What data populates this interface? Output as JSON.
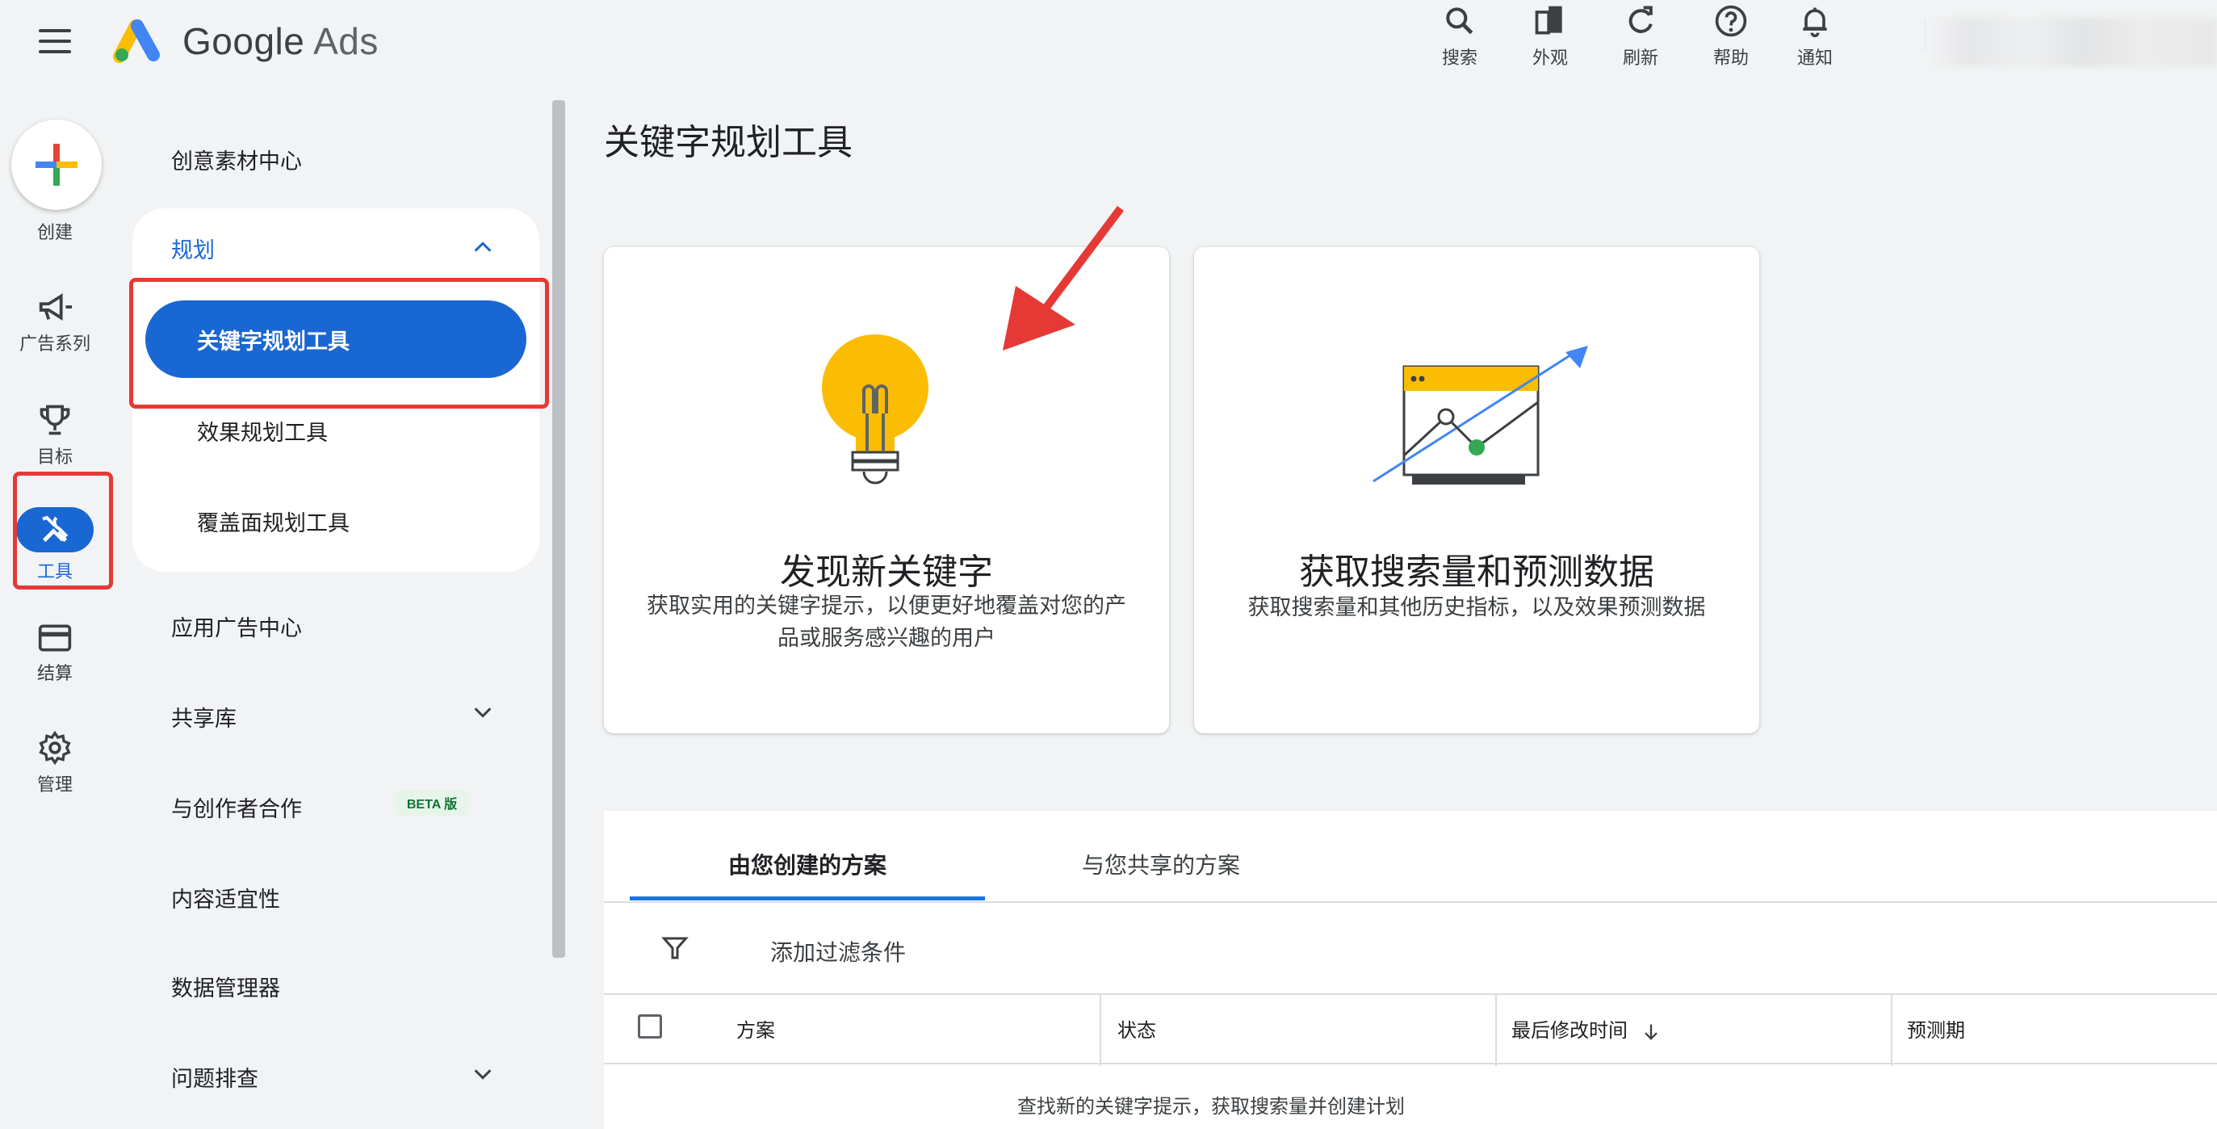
{
  "header": {
    "brand_google": "Google",
    "brand_ads": "Ads",
    "actions": [
      {
        "label": "搜索",
        "icon": "search-icon"
      },
      {
        "label": "外观",
        "icon": "appearance-icon"
      },
      {
        "label": "刷新",
        "icon": "refresh-icon"
      },
      {
        "label": "帮助",
        "icon": "help-icon"
      },
      {
        "label": "通知",
        "icon": "bell-icon"
      }
    ]
  },
  "rail": {
    "create": "创建",
    "campaigns": "广告系列",
    "goals": "目标",
    "tools": "工具",
    "billing": "结算",
    "admin": "管理"
  },
  "nav": {
    "creative_center": "创意素材中心",
    "planning": "规划",
    "keyword_planner": "关键字规划工具",
    "performance_planner": "效果规划工具",
    "reach_planner": "覆盖面规划工具",
    "app_center": "应用广告中心",
    "shared_library": "共享库",
    "creator_partnership": "与创作者合作",
    "beta": "BETA 版",
    "content_suitability": "内容适宜性",
    "data_manager": "数据管理器",
    "troubleshooting": "问题排查"
  },
  "main": {
    "title": "关键字规划工具",
    "card_discover": {
      "title": "发现新关键字",
      "desc": "获取实用的关键字提示，以便更好地覆盖对您的产品或服务感兴趣的用户"
    },
    "card_forecast": {
      "title": "获取搜索量和预测数据",
      "desc": "获取搜索量和其他历史指标，以及效果预测数据"
    },
    "tabs": [
      "由您创建的方案",
      "与您共享的方案"
    ],
    "filter": "添加过滤条件",
    "columns": [
      "方案",
      "状态",
      "最后修改时间",
      "预测期"
    ],
    "empty": "查找新的关键字提示，获取搜索量并创建计划"
  },
  "colors": {
    "accent": "#1967d2",
    "highlight": "#e53935",
    "bulb": "#fbbc04",
    "tab_underline": "#1a73e8"
  }
}
